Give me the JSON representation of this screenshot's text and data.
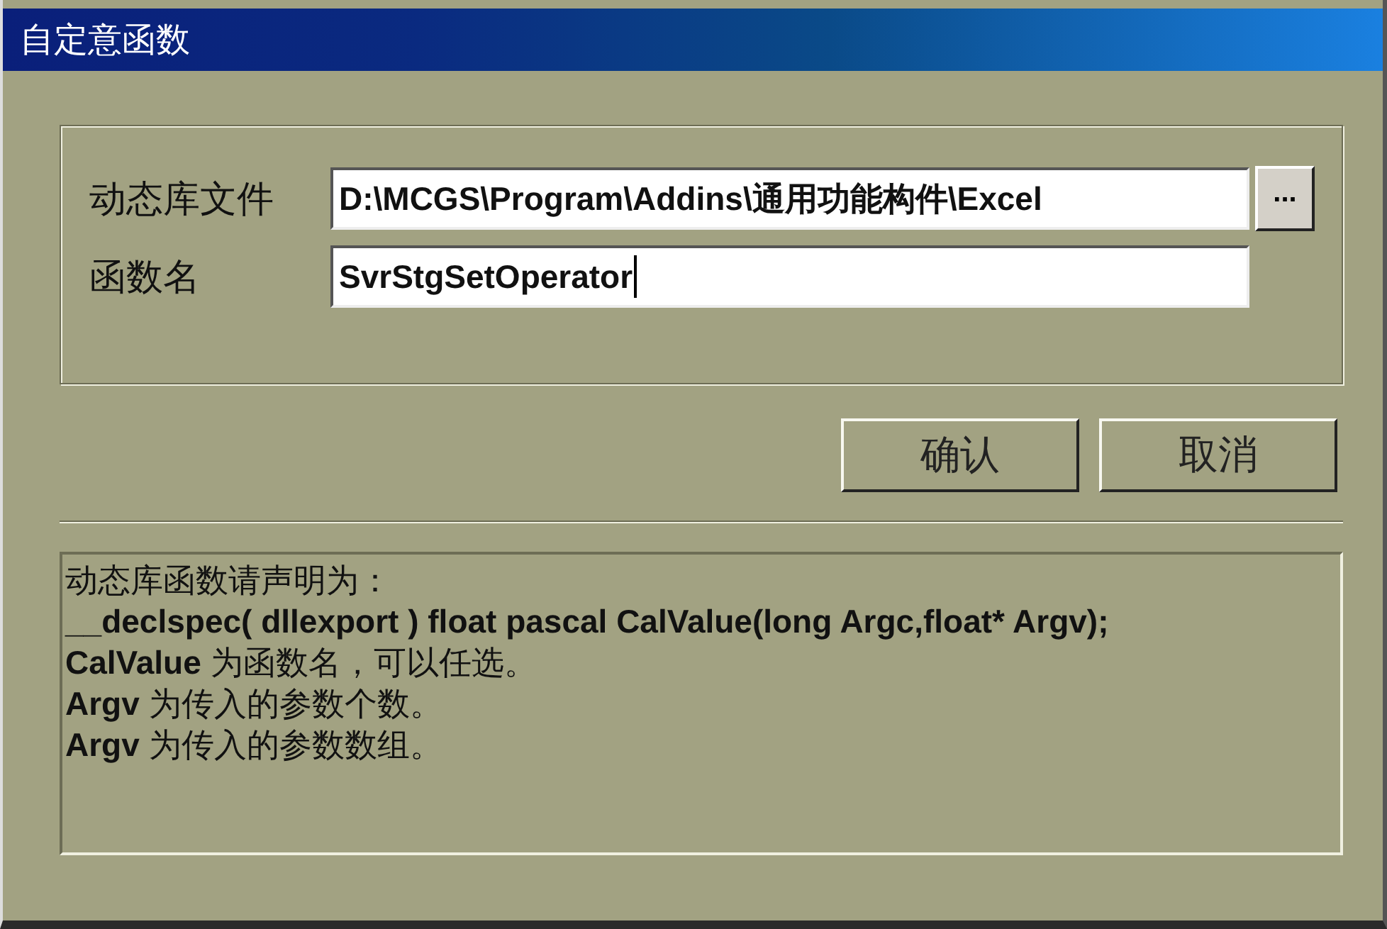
{
  "window": {
    "title": "自定意函数"
  },
  "fields": [
    {
      "label": "动态库文件",
      "value": "D:\\MCGS\\Program\\Addins\\通用功能构件\\Excel",
      "browse": "..."
    },
    {
      "label": "函数名",
      "value": "SvrStgSetOperator"
    }
  ],
  "buttons": [
    "确认",
    "取消"
  ],
  "info_lines": [
    {
      "kind": "text",
      "text": "动态库函数请声明为："
    },
    {
      "kind": "code",
      "text": "__declspec( dllexport ) float pascal CalValue(long Argc,float* Argv);"
    },
    {
      "kind": "text",
      "text": "**CalValue** 为函数名，可以任选。"
    },
    {
      "kind": "text",
      "text": "**Argv** 为传入的参数个数。"
    },
    {
      "kind": "text",
      "text": "**Argv** 为传入的参数数组。"
    }
  ]
}
